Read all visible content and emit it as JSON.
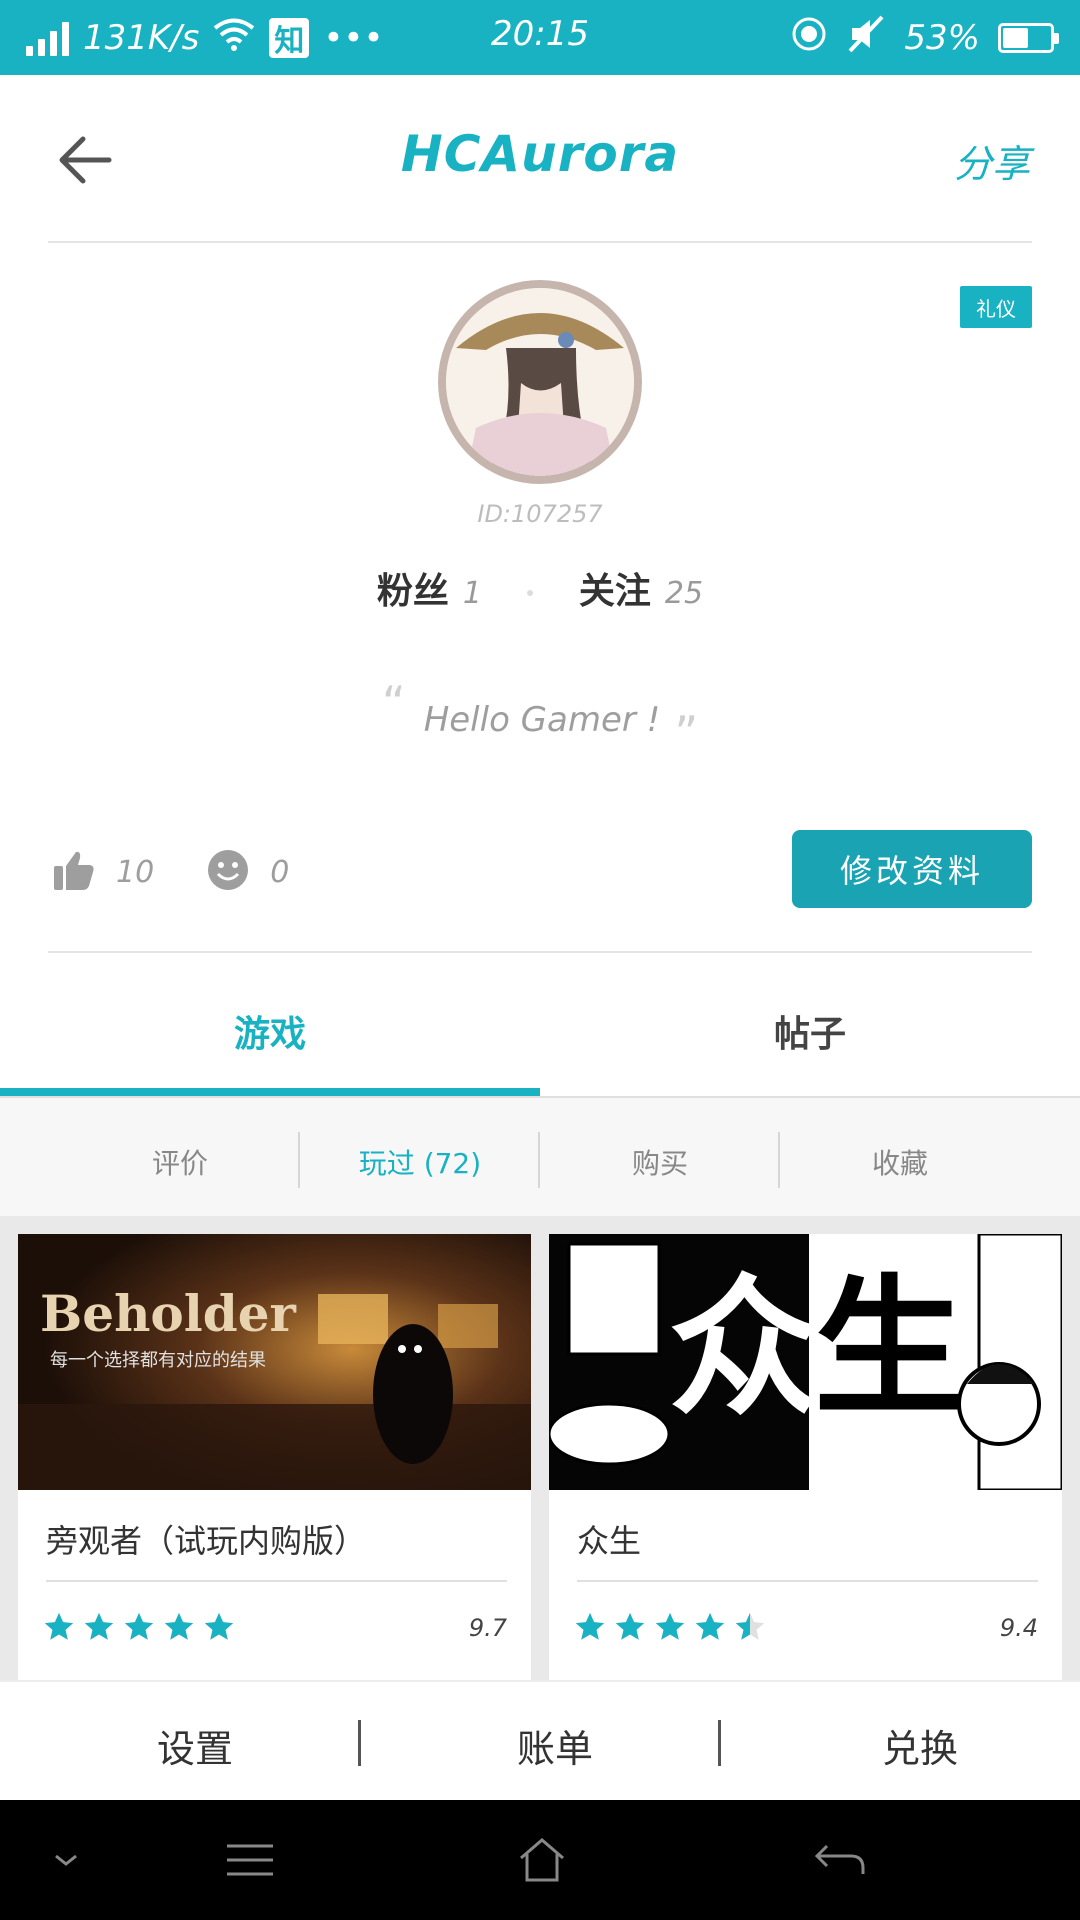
{
  "status_bar": {
    "speed": "131K/s",
    "app_badge": "知",
    "more": "•••",
    "time": "20:15",
    "battery": "53%",
    "battery_level": 0.53,
    "color": "#19b2c2"
  },
  "header": {
    "title": "HCAurora",
    "share_label": "分享",
    "back_icon": "arrow-left-icon"
  },
  "profile": {
    "badge": "礼仪",
    "user_id": "ID:107257",
    "fans_label": "粉丝",
    "fans_count": "1",
    "follow_label": "关注",
    "follow_count": "25",
    "motto": "Hello Gamer !",
    "likes_count": "10",
    "dislikes_count": "0",
    "edit_label": "修改资料"
  },
  "tabs": {
    "games": "游戏",
    "posts": "帖子",
    "active": "games"
  },
  "subtabs": {
    "review": "评价",
    "played": "玩过 (72)",
    "bought": "购买",
    "favorites": "收藏",
    "active": "played"
  },
  "games": [
    {
      "name": "旁观者（试玩内购版）",
      "art_title": "Beholder",
      "art_subtitle": "每一个选择都有对应的结果",
      "score": "9.7",
      "stars": 5
    },
    {
      "name": "众生",
      "art_text_1": "众",
      "art_text_2": "生",
      "score": "9.4",
      "stars": 4.5
    }
  ],
  "bottom_bar": {
    "settings": "设置",
    "bill": "账单",
    "redeem": "兑换"
  },
  "colors": {
    "accent": "#19b2c2",
    "button": "#19a3b3"
  }
}
